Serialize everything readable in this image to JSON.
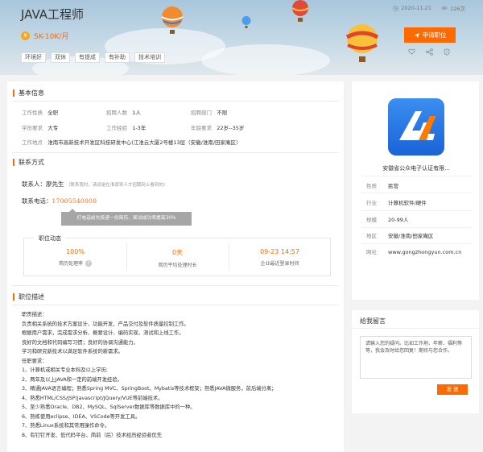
{
  "job": {
    "title": "JAVA工程师",
    "salary": "5K-10K/月",
    "salary_icon": "¥",
    "date": "2020-11-21",
    "views": "226次",
    "tags": [
      "环境好",
      "双休",
      "有提成",
      "有补助",
      "技术培训"
    ],
    "apply_label": "申请职位"
  },
  "basic": {
    "title": "基本信息",
    "rows": [
      [
        {
          "label": "工作性质",
          "value": "全职"
        },
        {
          "label": "招聘人数",
          "value": "1人"
        },
        {
          "label": "招聘部门",
          "value": "不限"
        }
      ],
      [
        {
          "label": "学历要求",
          "value": "大专"
        },
        {
          "label": "工作经验",
          "value": "1-3年"
        },
        {
          "label": "年龄要求",
          "value": "22岁--35岁"
        }
      ]
    ],
    "address_label": "工作地点",
    "address": "淮南市高新技术开发区科技研发中心(江淮云大厦2号楼13层（安徽/淮南/田家庵区）"
  },
  "contact": {
    "title": "联系方式",
    "person_label": "联系人：",
    "person": "廖先生",
    "person_note": "（联系我时，请说是在淮南导人才招聘网上看到的）",
    "phone_label": "联系电话：",
    "phone": "17005540000",
    "tooltip": "打电话前先投递一份简历，面试成功率提高30%"
  },
  "dynamics": {
    "title": "职位动态",
    "items": [
      {
        "value": "100%",
        "caption": "简历处理率"
      },
      {
        "value": "0天",
        "caption": "简历平均处理时长"
      },
      {
        "value": "09-23 14:57",
        "caption": "企业最近登录时间"
      }
    ]
  },
  "description": {
    "title": "职位描述",
    "lines": [
      "职责描述：",
      "负责相关系统的技术方案设计、功能开发、产品交付及软件质量控制工作。",
      "根据用户需求，完成需求分析、概要设计、编码实现、测试和上线工作。",
      "良好的文档和代码编写习惯；良好的协调沟通能力。",
      "学习和研究新技术以满足软件系统的新需求。",
      "任职要求：",
      "1、计算机或相关专业本科及以上学历;",
      "2、两年及以上JAVA和一定的前端开发经验。",
      "3、精通JAVA语言编程；熟悉Spring MVC、SpringBoot、Mybatis等技术框架；熟悉JAVA微服务，前后端分离；",
      "4、熟悉HTML/CSS/JSP/javascript/JQuery/VUE等前端技术。",
      "5、至少熟悉Oracle、DB2、MySQL、SqlServer数据库等数据库中的一种。",
      "6、熟练使用eclipse、IDEA、VSCode等开发工具。",
      "7、熟悉Linux系统和其常用操作命令。",
      "8、有钉钉开发、低代码平台、简前（后）技术经历经验者优先"
    ]
  },
  "company": {
    "name": "安徽省公众电子认证有限...",
    "logo_text": "CA",
    "rows": [
      {
        "label": "性质",
        "value": "民营"
      },
      {
        "label": "行业",
        "value": "计算机软件/硬件"
      },
      {
        "label": "规模",
        "value": "20-99人"
      },
      {
        "label": "地区",
        "value": "安徽/淮南/田家庵区"
      },
      {
        "label": "网址",
        "value": "www.gongzhongyun.com.cn"
      }
    ]
  },
  "message": {
    "title": "给我留言",
    "placeholder": "请输入您的疑问。比如工作地、年薪、福利等等，我会及时给您回复！期待与您合作。",
    "send_label": "发 送"
  },
  "colors": {
    "accent": "#ff6a00",
    "logo_blue": "#1a63d8"
  }
}
